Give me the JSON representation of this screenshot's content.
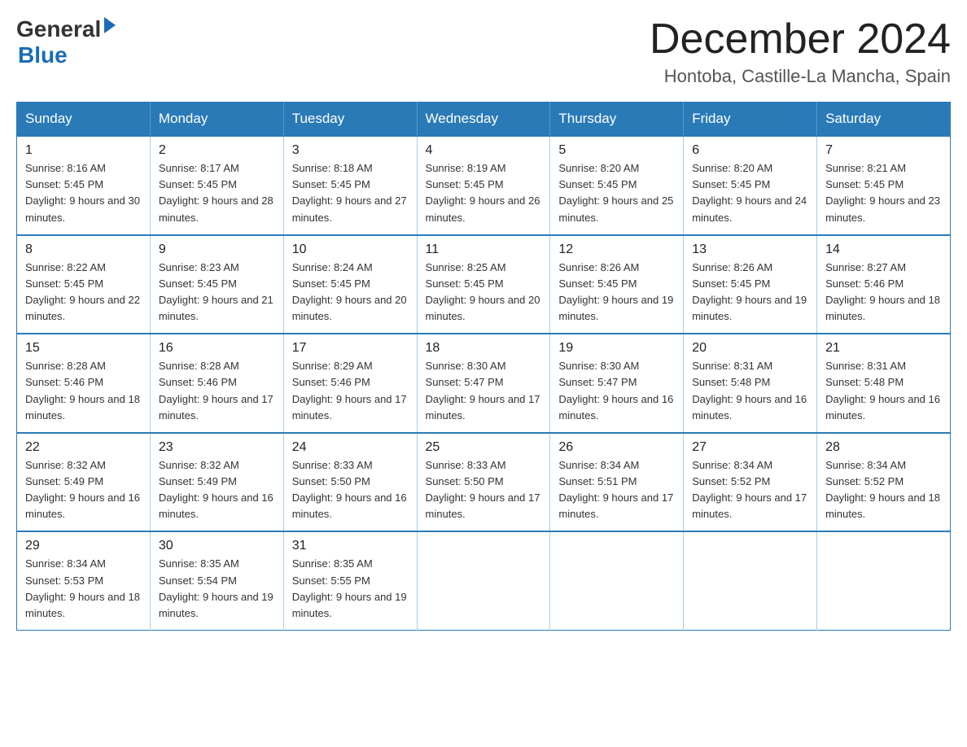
{
  "header": {
    "logo_general": "General",
    "logo_blue": "Blue",
    "title": "December 2024",
    "subtitle": "Hontoba, Castille-La Mancha, Spain"
  },
  "calendar": {
    "days_of_week": [
      "Sunday",
      "Monday",
      "Tuesday",
      "Wednesday",
      "Thursday",
      "Friday",
      "Saturday"
    ],
    "weeks": [
      [
        {
          "day": "1",
          "sunrise": "Sunrise: 8:16 AM",
          "sunset": "Sunset: 5:45 PM",
          "daylight": "Daylight: 9 hours and 30 minutes."
        },
        {
          "day": "2",
          "sunrise": "Sunrise: 8:17 AM",
          "sunset": "Sunset: 5:45 PM",
          "daylight": "Daylight: 9 hours and 28 minutes."
        },
        {
          "day": "3",
          "sunrise": "Sunrise: 8:18 AM",
          "sunset": "Sunset: 5:45 PM",
          "daylight": "Daylight: 9 hours and 27 minutes."
        },
        {
          "day": "4",
          "sunrise": "Sunrise: 8:19 AM",
          "sunset": "Sunset: 5:45 PM",
          "daylight": "Daylight: 9 hours and 26 minutes."
        },
        {
          "day": "5",
          "sunrise": "Sunrise: 8:20 AM",
          "sunset": "Sunset: 5:45 PM",
          "daylight": "Daylight: 9 hours and 25 minutes."
        },
        {
          "day": "6",
          "sunrise": "Sunrise: 8:20 AM",
          "sunset": "Sunset: 5:45 PM",
          "daylight": "Daylight: 9 hours and 24 minutes."
        },
        {
          "day": "7",
          "sunrise": "Sunrise: 8:21 AM",
          "sunset": "Sunset: 5:45 PM",
          "daylight": "Daylight: 9 hours and 23 minutes."
        }
      ],
      [
        {
          "day": "8",
          "sunrise": "Sunrise: 8:22 AM",
          "sunset": "Sunset: 5:45 PM",
          "daylight": "Daylight: 9 hours and 22 minutes."
        },
        {
          "day": "9",
          "sunrise": "Sunrise: 8:23 AM",
          "sunset": "Sunset: 5:45 PM",
          "daylight": "Daylight: 9 hours and 21 minutes."
        },
        {
          "day": "10",
          "sunrise": "Sunrise: 8:24 AM",
          "sunset": "Sunset: 5:45 PM",
          "daylight": "Daylight: 9 hours and 20 minutes."
        },
        {
          "day": "11",
          "sunrise": "Sunrise: 8:25 AM",
          "sunset": "Sunset: 5:45 PM",
          "daylight": "Daylight: 9 hours and 20 minutes."
        },
        {
          "day": "12",
          "sunrise": "Sunrise: 8:26 AM",
          "sunset": "Sunset: 5:45 PM",
          "daylight": "Daylight: 9 hours and 19 minutes."
        },
        {
          "day": "13",
          "sunrise": "Sunrise: 8:26 AM",
          "sunset": "Sunset: 5:45 PM",
          "daylight": "Daylight: 9 hours and 19 minutes."
        },
        {
          "day": "14",
          "sunrise": "Sunrise: 8:27 AM",
          "sunset": "Sunset: 5:46 PM",
          "daylight": "Daylight: 9 hours and 18 minutes."
        }
      ],
      [
        {
          "day": "15",
          "sunrise": "Sunrise: 8:28 AM",
          "sunset": "Sunset: 5:46 PM",
          "daylight": "Daylight: 9 hours and 18 minutes."
        },
        {
          "day": "16",
          "sunrise": "Sunrise: 8:28 AM",
          "sunset": "Sunset: 5:46 PM",
          "daylight": "Daylight: 9 hours and 17 minutes."
        },
        {
          "day": "17",
          "sunrise": "Sunrise: 8:29 AM",
          "sunset": "Sunset: 5:46 PM",
          "daylight": "Daylight: 9 hours and 17 minutes."
        },
        {
          "day": "18",
          "sunrise": "Sunrise: 8:30 AM",
          "sunset": "Sunset: 5:47 PM",
          "daylight": "Daylight: 9 hours and 17 minutes."
        },
        {
          "day": "19",
          "sunrise": "Sunrise: 8:30 AM",
          "sunset": "Sunset: 5:47 PM",
          "daylight": "Daylight: 9 hours and 16 minutes."
        },
        {
          "day": "20",
          "sunrise": "Sunrise: 8:31 AM",
          "sunset": "Sunset: 5:48 PM",
          "daylight": "Daylight: 9 hours and 16 minutes."
        },
        {
          "day": "21",
          "sunrise": "Sunrise: 8:31 AM",
          "sunset": "Sunset: 5:48 PM",
          "daylight": "Daylight: 9 hours and 16 minutes."
        }
      ],
      [
        {
          "day": "22",
          "sunrise": "Sunrise: 8:32 AM",
          "sunset": "Sunset: 5:49 PM",
          "daylight": "Daylight: 9 hours and 16 minutes."
        },
        {
          "day": "23",
          "sunrise": "Sunrise: 8:32 AM",
          "sunset": "Sunset: 5:49 PM",
          "daylight": "Daylight: 9 hours and 16 minutes."
        },
        {
          "day": "24",
          "sunrise": "Sunrise: 8:33 AM",
          "sunset": "Sunset: 5:50 PM",
          "daylight": "Daylight: 9 hours and 16 minutes."
        },
        {
          "day": "25",
          "sunrise": "Sunrise: 8:33 AM",
          "sunset": "Sunset: 5:50 PM",
          "daylight": "Daylight: 9 hours and 17 minutes."
        },
        {
          "day": "26",
          "sunrise": "Sunrise: 8:34 AM",
          "sunset": "Sunset: 5:51 PM",
          "daylight": "Daylight: 9 hours and 17 minutes."
        },
        {
          "day": "27",
          "sunrise": "Sunrise: 8:34 AM",
          "sunset": "Sunset: 5:52 PM",
          "daylight": "Daylight: 9 hours and 17 minutes."
        },
        {
          "day": "28",
          "sunrise": "Sunrise: 8:34 AM",
          "sunset": "Sunset: 5:52 PM",
          "daylight": "Daylight: 9 hours and 18 minutes."
        }
      ],
      [
        {
          "day": "29",
          "sunrise": "Sunrise: 8:34 AM",
          "sunset": "Sunset: 5:53 PM",
          "daylight": "Daylight: 9 hours and 18 minutes."
        },
        {
          "day": "30",
          "sunrise": "Sunrise: 8:35 AM",
          "sunset": "Sunset: 5:54 PM",
          "daylight": "Daylight: 9 hours and 19 minutes."
        },
        {
          "day": "31",
          "sunrise": "Sunrise: 8:35 AM",
          "sunset": "Sunset: 5:55 PM",
          "daylight": "Daylight: 9 hours and 19 minutes."
        },
        null,
        null,
        null,
        null
      ]
    ]
  }
}
